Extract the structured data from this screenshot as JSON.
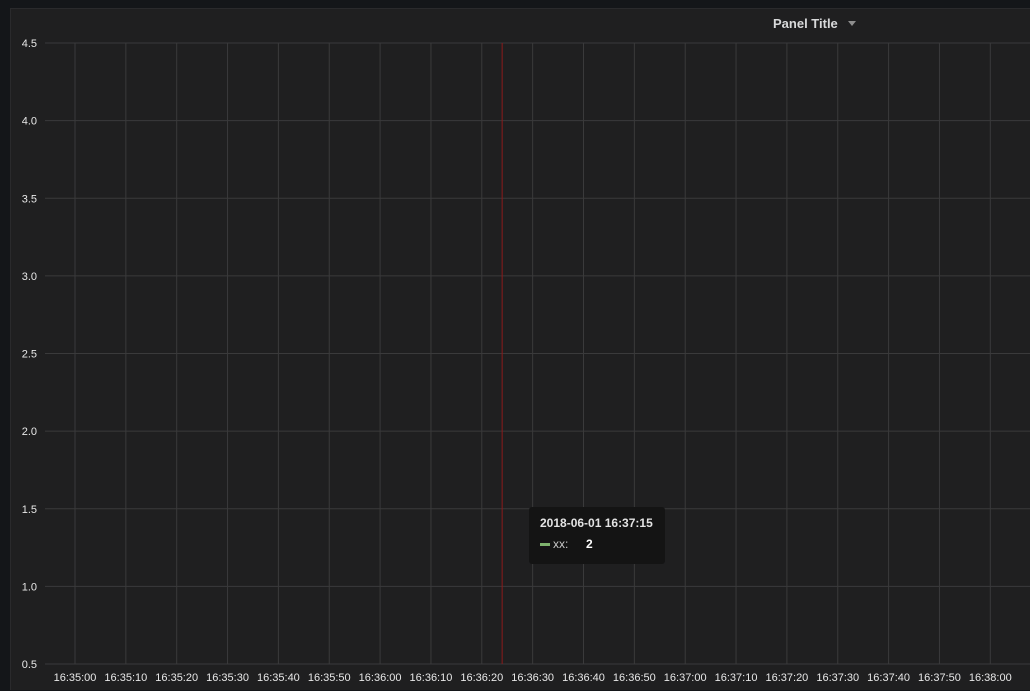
{
  "panel": {
    "title": "Panel Title",
    "menu_icon": "caret-down-icon"
  },
  "colors": {
    "background": "#1f1f20",
    "grid": "#3a3a3b",
    "tick_text": "#e8e8e8",
    "crosshair": "#8b1a1a",
    "series_xx": "#7eb26d"
  },
  "chart_data": {
    "type": "line",
    "x_ticks": [
      "16:35:00",
      "16:35:10",
      "16:35:20",
      "16:35:30",
      "16:35:40",
      "16:35:50",
      "16:36:00",
      "16:36:10",
      "16:36:20",
      "16:36:30",
      "16:36:40",
      "16:36:50",
      "16:37:00",
      "16:37:10",
      "16:37:20",
      "16:37:30",
      "16:37:40",
      "16:37:50",
      "16:38:00"
    ],
    "y_ticks": [
      "0.5",
      "1.0",
      "1.5",
      "2.0",
      "2.5",
      "3.0",
      "3.5",
      "4.0",
      "4.5"
    ],
    "ylim": [
      0.5,
      4.5
    ],
    "grid": true,
    "series": [
      {
        "name": "xx",
        "points": []
      }
    ],
    "crosshair_time": "16:36:24"
  },
  "tooltip": {
    "timestamp": "2018-06-01 16:37:15",
    "series_label": "xx:",
    "value": "2"
  }
}
